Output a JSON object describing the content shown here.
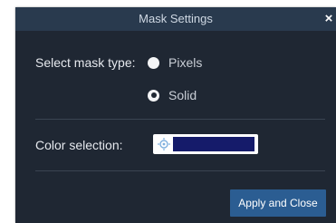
{
  "dialog": {
    "title": "Mask Settings",
    "close_icon": "close-icon"
  },
  "mask_type": {
    "label": "Select mask type:",
    "options": [
      {
        "label": "Pixels",
        "selected": false
      },
      {
        "label": "Solid",
        "selected": true
      }
    ]
  },
  "color_selection": {
    "label": "Color selection:",
    "icon": "color-picker-icon",
    "value_color": "#151b6a"
  },
  "footer": {
    "apply_label": "Apply and Close"
  },
  "colors": {
    "dialog_bg": "#1f2733",
    "titlebar_bg": "#293a4e",
    "button_bg": "#2b5d92"
  }
}
